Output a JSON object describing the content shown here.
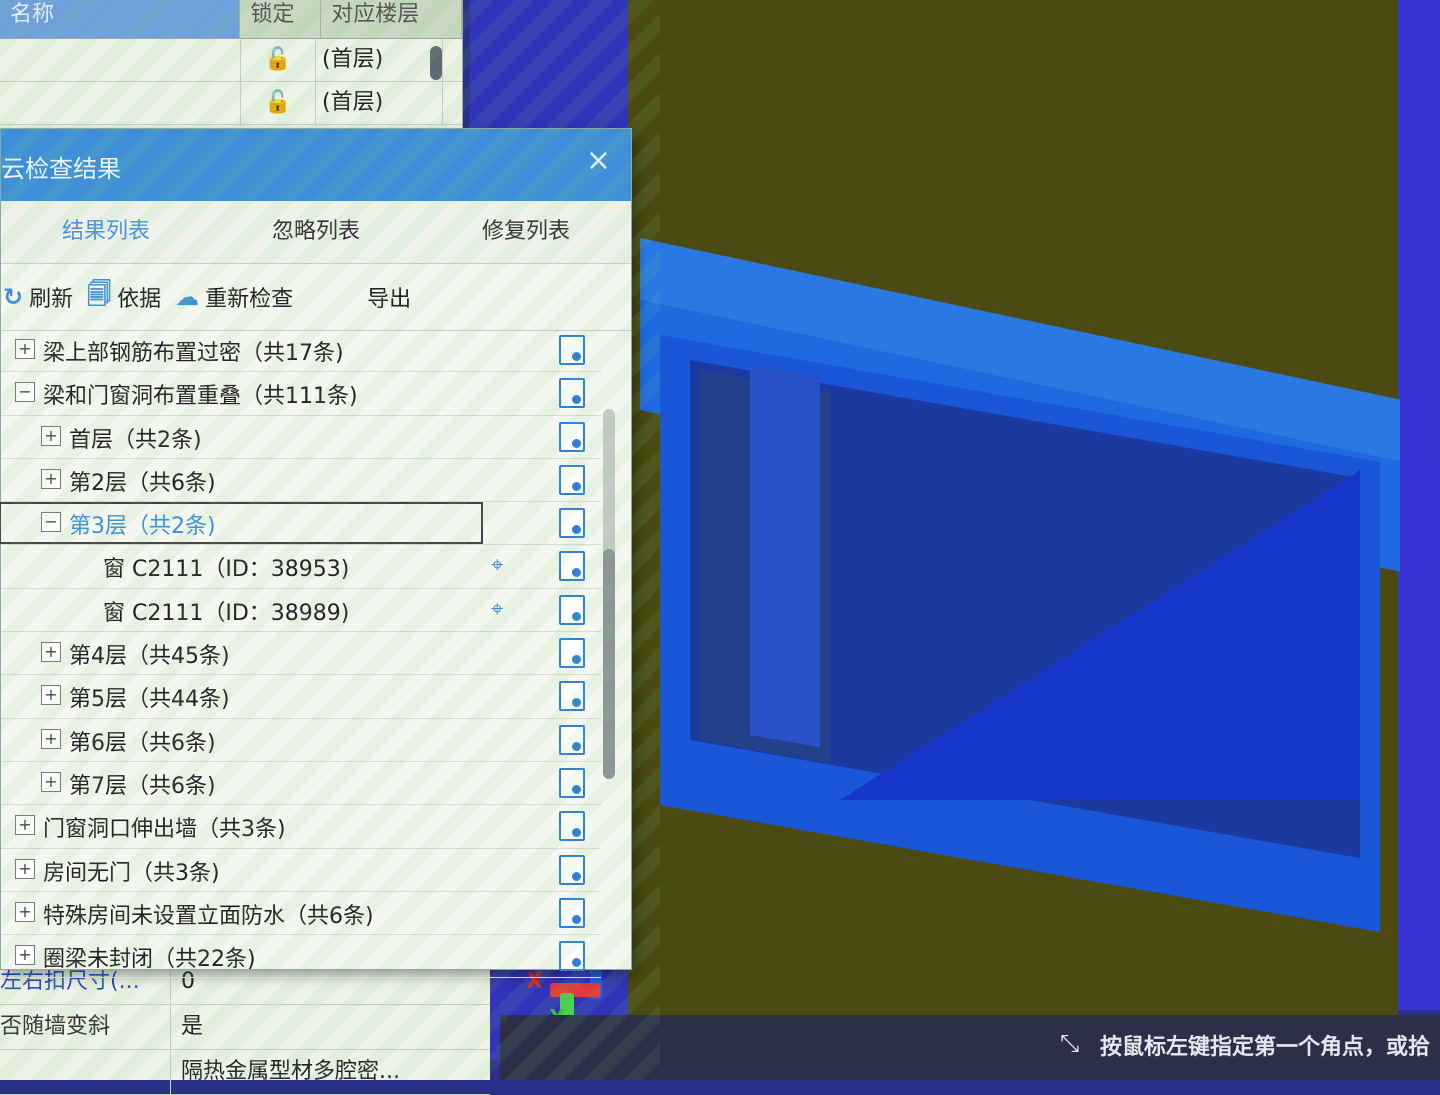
{
  "floor_list": {
    "columns": [
      "名称",
      "锁定",
      "对应楼层"
    ],
    "rows": [
      {
        "name": "",
        "floor": "(首层)"
      },
      {
        "name": "",
        "floor": "(首层)"
      }
    ]
  },
  "dialog": {
    "title": "云检查结果",
    "close": "×",
    "tabs": [
      "结果列表",
      "忽略列表",
      "修复列表"
    ],
    "active_tab": "结果列表",
    "toolbar": {
      "refresh": "刷新",
      "basis": "依据",
      "recheck": "重新检查",
      "export": "导出"
    },
    "tree": [
      {
        "label": "梁上部钢筋布置过密（共17条)",
        "toggle": "+",
        "depth": 0
      },
      {
        "label": "梁和门窗洞布置重叠（共111条)",
        "toggle": "−",
        "depth": 0
      },
      {
        "label": "首层（共2条)",
        "toggle": "+",
        "depth": 1
      },
      {
        "label": "第2层（共6条)",
        "toggle": "+",
        "depth": 1
      },
      {
        "label": "第3层（共2条)",
        "toggle": "−",
        "depth": 1,
        "selected": true
      },
      {
        "label": "窗 C2111（ID：38953)",
        "toggle": "",
        "depth": 2,
        "locate": true
      },
      {
        "label": "窗 C2111（ID：38989)",
        "toggle": "",
        "depth": 2,
        "locate": true
      },
      {
        "label": "第4层（共45条)",
        "toggle": "+",
        "depth": 1
      },
      {
        "label": "第5层（共44条)",
        "toggle": "+",
        "depth": 1
      },
      {
        "label": "第6层（共6条)",
        "toggle": "+",
        "depth": 1
      },
      {
        "label": "第7层（共6条)",
        "toggle": "+",
        "depth": 1
      },
      {
        "label": "门窗洞口伸出墙（共3条)",
        "toggle": "+",
        "depth": 0
      },
      {
        "label": "房间无门（共3条)",
        "toggle": "+",
        "depth": 0
      },
      {
        "label": "特殊房间未设置立面防水（共6条)",
        "toggle": "+",
        "depth": 0
      },
      {
        "label": "圈梁未封闭（共22条)",
        "toggle": "+",
        "depth": 0
      }
    ]
  },
  "properties": [
    {
      "key": "左右扣尺寸(...",
      "value": "0"
    },
    {
      "key": "否随墙变斜",
      "value": "是"
    },
    {
      "key": "",
      "value": "隔热金属型材多腔密..."
    }
  ],
  "axis": {
    "x": "X",
    "y": "Y"
  },
  "status": {
    "text": "按鼠标左键指定第一个角点，或拾"
  },
  "colors": {
    "accent": "#3f8fd8",
    "viewport_bg": "#4a4a12",
    "beam": "#2a79e3"
  }
}
